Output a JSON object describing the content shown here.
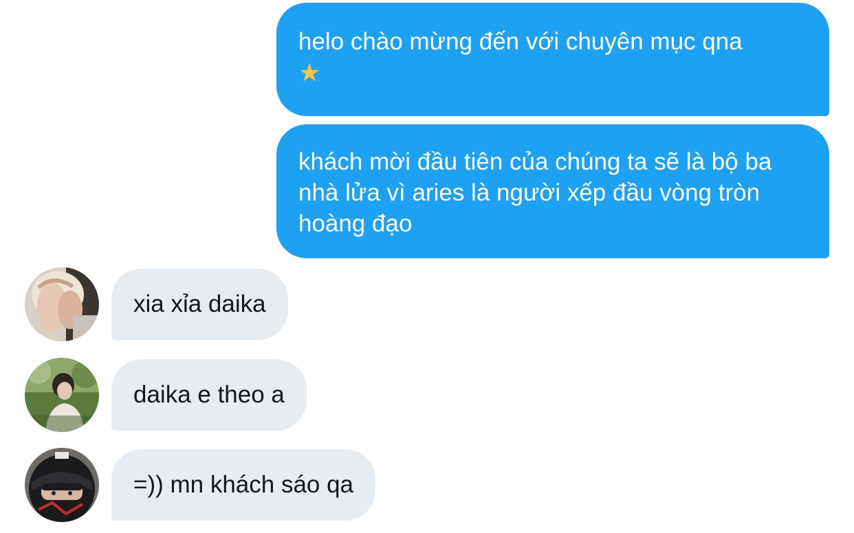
{
  "conversation": {
    "sent": [
      {
        "text": "helo chào mừng đến với chuyên mục qna",
        "emoji_icon": "star-emoji-icon"
      },
      {
        "text": "khách mời đầu tiên của chúng ta sẽ là bộ ba nhà lửa vì aries là người xếp đầu vòng tròn hoàng đạo"
      }
    ],
    "received": [
      {
        "text": "xia xỉa daika",
        "avatar_icon": "avatar-photo-1"
      },
      {
        "text": "daika e theo a",
        "avatar_icon": "avatar-photo-2"
      },
      {
        "text": "=)) mn khách sáo qa",
        "avatar_icon": "avatar-photo-3"
      }
    ]
  },
  "colors": {
    "sent_bubble": "#1da1f2",
    "received_bubble": "#e6ecf0",
    "star": "#f6c343"
  }
}
